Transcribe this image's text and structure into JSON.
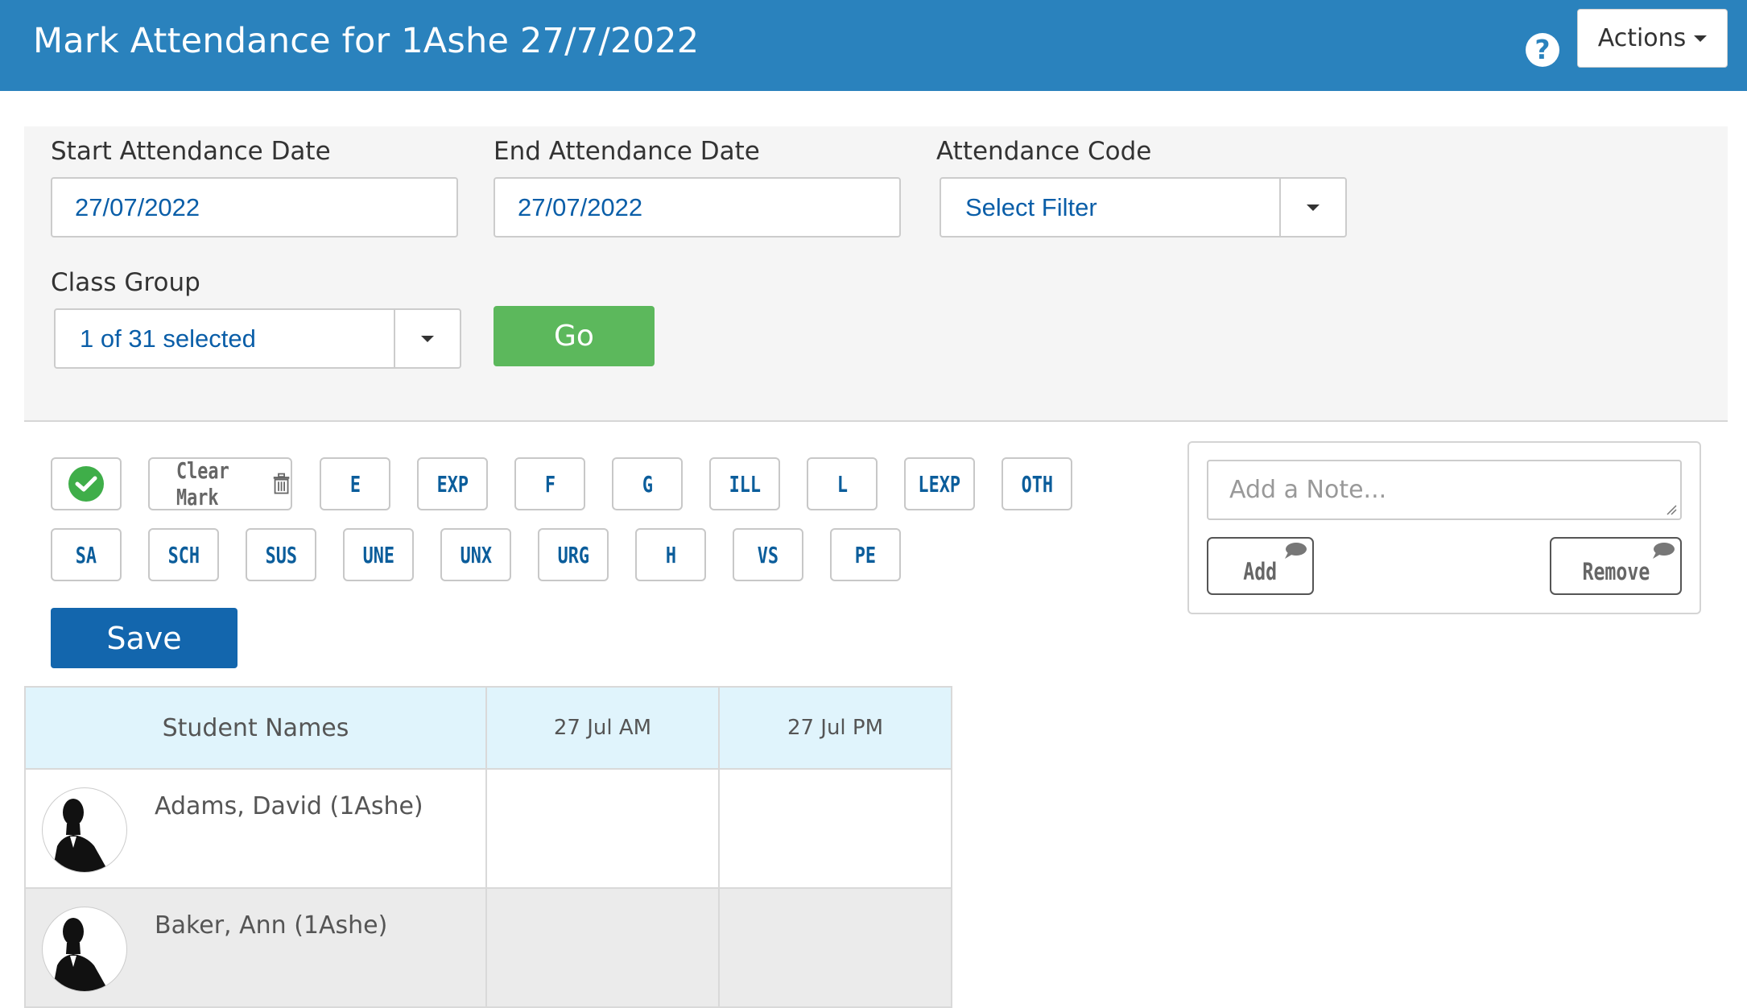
{
  "header": {
    "title": "Mark Attendance for 1Ashe 27/7/2022",
    "help_icon": "?",
    "actions_label": "Actions"
  },
  "filters": {
    "start_label": "Start Attendance Date",
    "start_value": "27/07/2022",
    "end_label": "End Attendance Date",
    "end_value": "27/07/2022",
    "code_label": "Attendance Code",
    "code_value": "Select Filter",
    "class_group_label": "Class Group",
    "class_group_value": "1 of 31 selected",
    "go_label": "Go"
  },
  "codes": {
    "clear_label": "Clear Mark",
    "row1": [
      "E",
      "EXP",
      "F",
      "G",
      "ILL",
      "L",
      "LEXP",
      "OTH"
    ],
    "row2": [
      "SA",
      "SCH",
      "SUS",
      "UNE",
      "UNX",
      "URG",
      "H",
      "VS",
      "PE"
    ]
  },
  "save_label": "Save",
  "note": {
    "placeholder": "Add a Note...",
    "add_label": "Add",
    "remove_label": "Remove"
  },
  "table": {
    "headers": [
      "Student Names",
      "27 Jul AM",
      "27 Jul PM"
    ],
    "students": [
      {
        "name": "Adams, David (1Ashe)",
        "am": "",
        "pm": ""
      },
      {
        "name": "Baker, Ann (1Ashe)",
        "am": "",
        "pm": ""
      }
    ]
  },
  "colors": {
    "header_bg": "#2a82bd",
    "go_green": "#5cb85c",
    "save_blue": "#1366ad",
    "code_text": "#0b5d9b",
    "table_header_bg": "#e0f4fc"
  }
}
